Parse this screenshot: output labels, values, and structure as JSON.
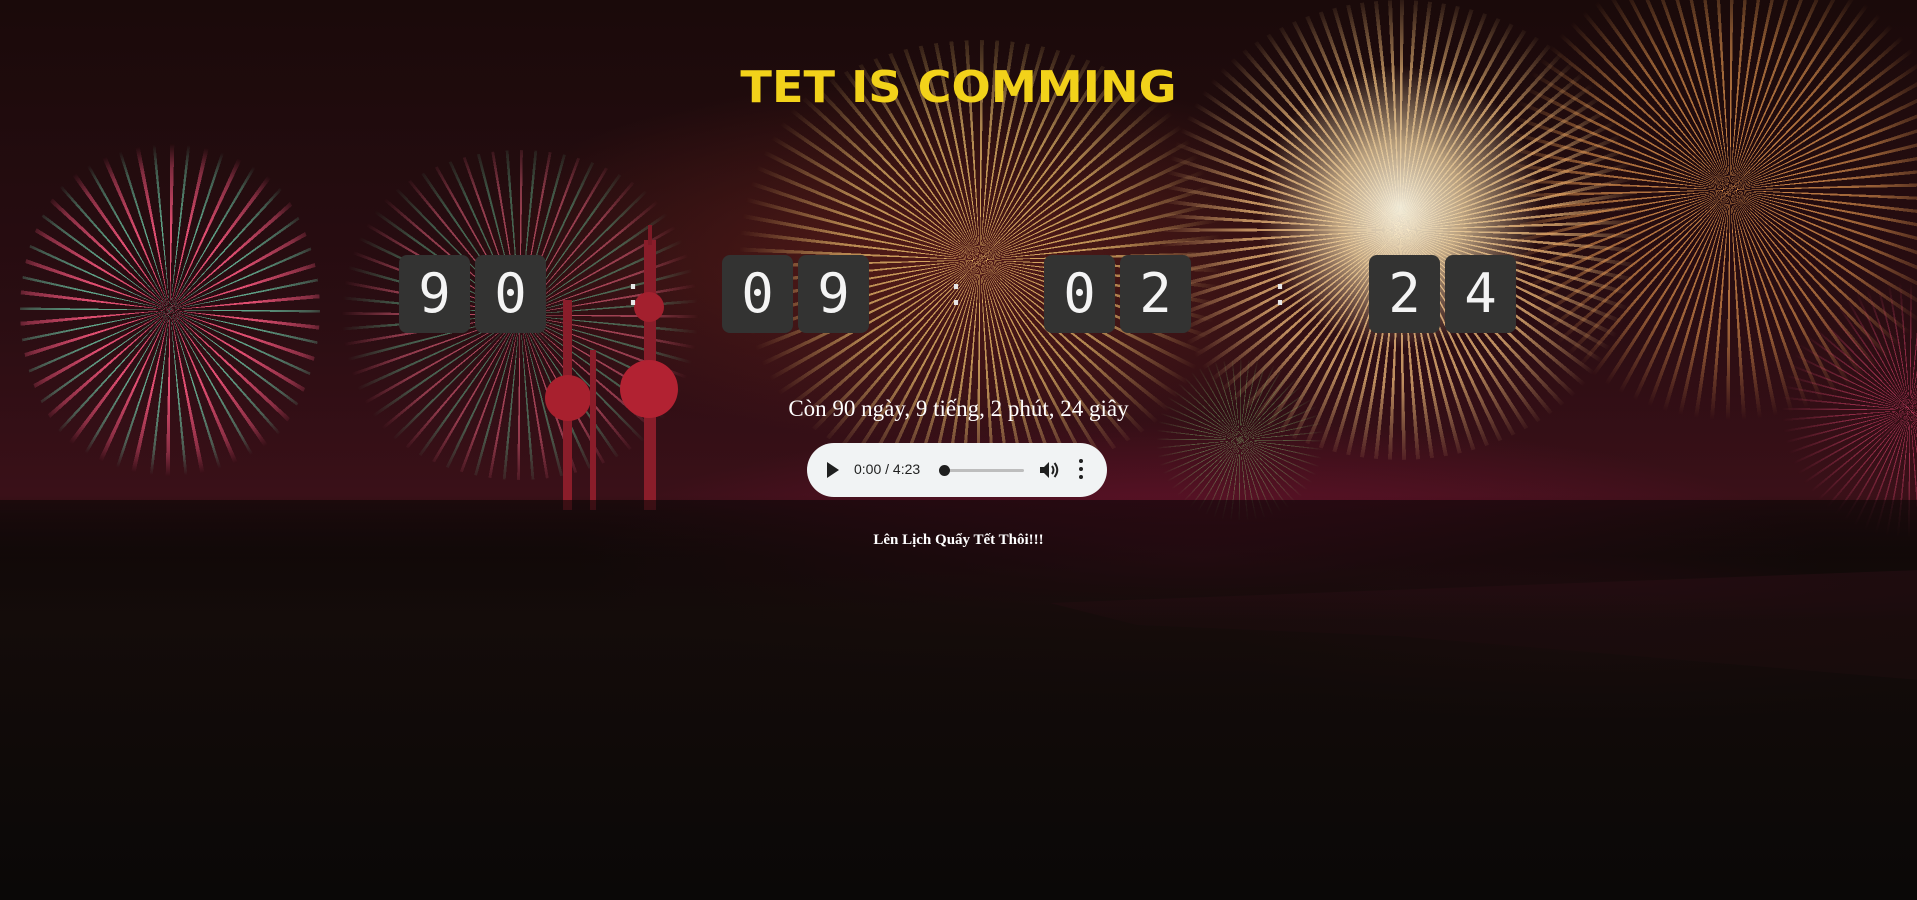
{
  "page": {
    "title": "TET IS COMMING",
    "title_color": "#f2d21a"
  },
  "countdown": {
    "days": [
      "9",
      "0"
    ],
    "hours": [
      "0",
      "9"
    ],
    "minutes": [
      "0",
      "2"
    ],
    "seconds": [
      "2",
      "4"
    ],
    "separator": ":",
    "summary": "Còn 90 ngày, 9 tiếng, 2 phút, 24 giây"
  },
  "audio_player": {
    "time_display": "0:00 / 4:23",
    "progress": 0.0,
    "icons": {
      "play": "play-icon",
      "volume": "volume-icon",
      "more": "more-vert-icon"
    }
  },
  "schedule_link": {
    "label": "Lên Lịch Quẩy Tết Thôi!!!"
  }
}
